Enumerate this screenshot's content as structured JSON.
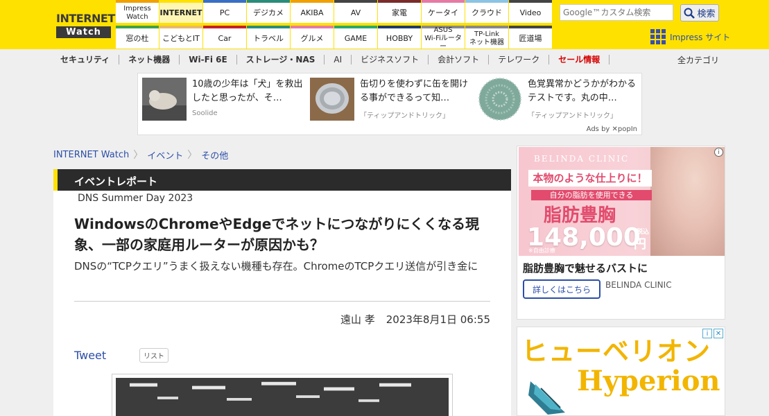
{
  "logo": {
    "line1": "INTERNET",
    "line2": "Watch"
  },
  "nav": [
    {
      "label": "Impress\nWatch",
      "color": "#f0a000",
      "active": false
    },
    {
      "label": "INTERNET",
      "color": "#ffe100",
      "active": true
    },
    {
      "label": "PC",
      "color": "#3a6fc4",
      "active": false
    },
    {
      "label": "デジカメ",
      "color": "#2b8c7a",
      "active": false
    },
    {
      "label": "AKIBA",
      "color": "#f0a000",
      "active": false
    },
    {
      "label": "AV",
      "color": "#444444",
      "active": false
    },
    {
      "label": "家電",
      "color": "#7a2c2c",
      "active": false
    },
    {
      "label": "ケータイ",
      "color": "#e67aa5",
      "active": false
    },
    {
      "label": "クラウド",
      "color": "#8cc4e3",
      "active": false
    },
    {
      "label": "Video",
      "color": "#444444",
      "active": false
    },
    {
      "label": "窓の杜",
      "color": "#3fa04a",
      "active": false
    },
    {
      "label": "こどもとIT",
      "color": "#e8b96a",
      "active": false
    },
    {
      "label": "Car",
      "color": "#c4202b",
      "active": false
    },
    {
      "label": "トラベル",
      "color": "#2b8c7a",
      "active": false
    },
    {
      "label": "グルメ",
      "color": "#e67aa5",
      "active": false
    },
    {
      "label": "GAME",
      "color": "#2aa86a",
      "active": false
    },
    {
      "label": "HOBBY",
      "color": "#1e3a6a",
      "active": false
    },
    {
      "label": "ASUS\nWi-Fiルーター",
      "color": "#888888",
      "active": false
    },
    {
      "label": "TP-Link\nネット機器",
      "color": "#888888",
      "active": false
    },
    {
      "label": "匠道場",
      "color": "#444444",
      "active": false
    }
  ],
  "search": {
    "placeholder": "Google™カスタム検索",
    "button": "検索"
  },
  "impress_site": "Impress サイト",
  "categories": [
    {
      "label": "セキュリティ",
      "style": "bold"
    },
    {
      "label": "ネット機器",
      "style": "bold"
    },
    {
      "label": "Wi-Fi 6E",
      "style": "bold"
    },
    {
      "label": "ストレージ・NAS",
      "style": "bold"
    },
    {
      "label": "AI",
      "style": ""
    },
    {
      "label": "ビジネスソフト",
      "style": ""
    },
    {
      "label": "会計ソフト",
      "style": ""
    },
    {
      "label": "テレワーク",
      "style": ""
    },
    {
      "label": "セール情報",
      "style": "red"
    }
  ],
  "all_categories": "全カテゴリ",
  "sponsored": [
    {
      "title": "10歳の少年は「犬」を救出したと思ったが、そ…",
      "source": "Soolide"
    },
    {
      "title": "缶切りを使わずに缶を開ける事ができるって知…",
      "source": "「ティップアンドトリック」"
    },
    {
      "title": "色覚異常かどうかがわかるテストです。丸の中…",
      "source": "「ティップアンドトリック」"
    }
  ],
  "ads_by": "Ads by ✕popIn",
  "breadcrumb": [
    "INTERNET Watch",
    "イベント",
    "その他"
  ],
  "article": {
    "category": "イベントレポート",
    "event": "DNS Summer Day 2023",
    "headline": "WindowsのChromeやEdgeでネットにつながりにくくなる現象、一部の家庭用ルーターが原因かも？",
    "subhead": "DNSの“TCPクエリ”うまく扱えない機種も存在。ChromeのTCPクエリ送信が引き金に",
    "author": "遠山 孝",
    "date": "2023年8月1日 06:55",
    "tweet": "Tweet",
    "list_badge": "リスト"
  },
  "ad1": {
    "brand": "BELINDA CLINIC",
    "ribbon": "本物のような仕上りに！",
    "sub": "自分の脂肪を使用できる",
    "main": "脂肪豊胸",
    "price": "148,000",
    "yen": "円",
    "tax": "税込",
    "note": "※自由診療",
    "headline": "脂肪豊胸で魅せるバストに",
    "cta": "詳しくはこちら",
    "advertiser": "BELINDA CLINIC"
  },
  "ad2": {
    "kana": "ヒューベリオン",
    "latin": "Hyperion"
  }
}
